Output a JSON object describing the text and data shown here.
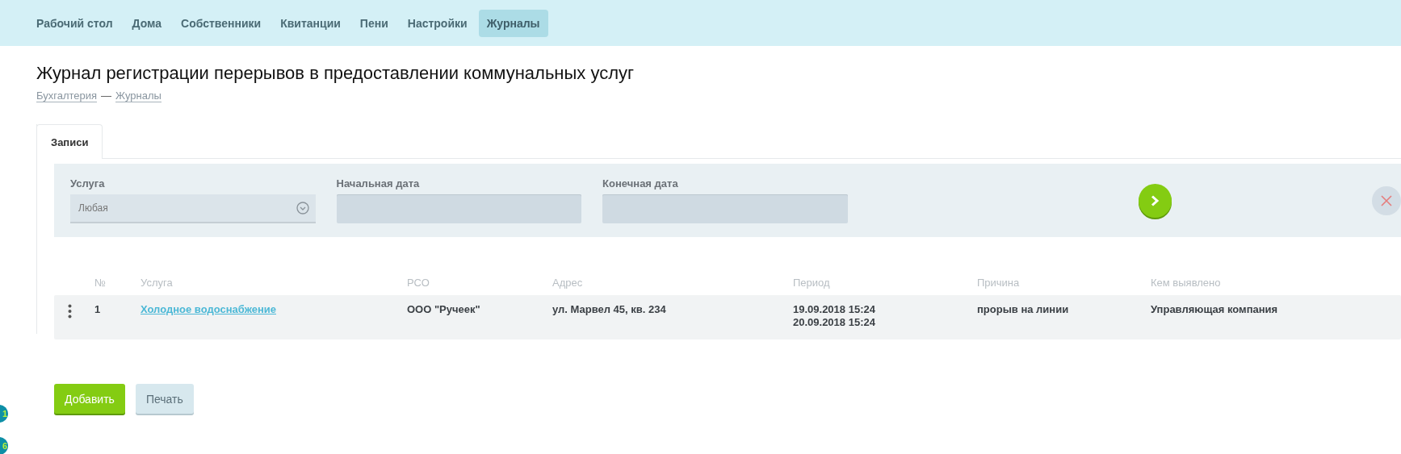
{
  "nav": {
    "items": [
      {
        "label": "Рабочий стол",
        "selected": false
      },
      {
        "label": "Дома",
        "selected": false
      },
      {
        "label": "Собственники",
        "selected": false
      },
      {
        "label": "Квитанции",
        "selected": false
      },
      {
        "label": "Пени",
        "selected": false
      },
      {
        "label": "Настройки",
        "selected": false
      },
      {
        "label": "Журналы",
        "selected": true
      }
    ]
  },
  "page": {
    "title": "Журнал регистрации перерывов в предоставлении коммунальных услуг",
    "breadcrumbs": [
      "Бухгалтерия",
      "Журналы"
    ],
    "breadcrumb_separator": "—"
  },
  "tabs": [
    {
      "label": "Записи",
      "selected": true
    }
  ],
  "filter": {
    "fields": [
      {
        "kind": "select",
        "label": "Услуга",
        "value": "Любая"
      },
      {
        "kind": "date",
        "label": "Начальная дата"
      },
      {
        "kind": "date",
        "label": "Конечная дата"
      }
    ]
  },
  "table": {
    "columns": [
      "№",
      "Услуга",
      "РСО",
      "Адрес",
      "Период",
      "Причина",
      "Кем выявлено"
    ],
    "rows": [
      {
        "number": "1",
        "service": "Холодное водоснабжение",
        "rso": "ООО \"Ручеек\"",
        "address": "ул. Марвел 45, кв. 234",
        "period": [
          "19.09.2018 15:24",
          "20.09.2018 15:24"
        ],
        "reason": "прорыв на линии",
        "detected_by": "Управляющая компания"
      }
    ]
  },
  "buttons": [
    {
      "label": "Добавить",
      "kind": "primary"
    },
    {
      "label": "Печать",
      "kind": "secondary"
    }
  ],
  "side_badges": [
    "1",
    "6"
  ]
}
